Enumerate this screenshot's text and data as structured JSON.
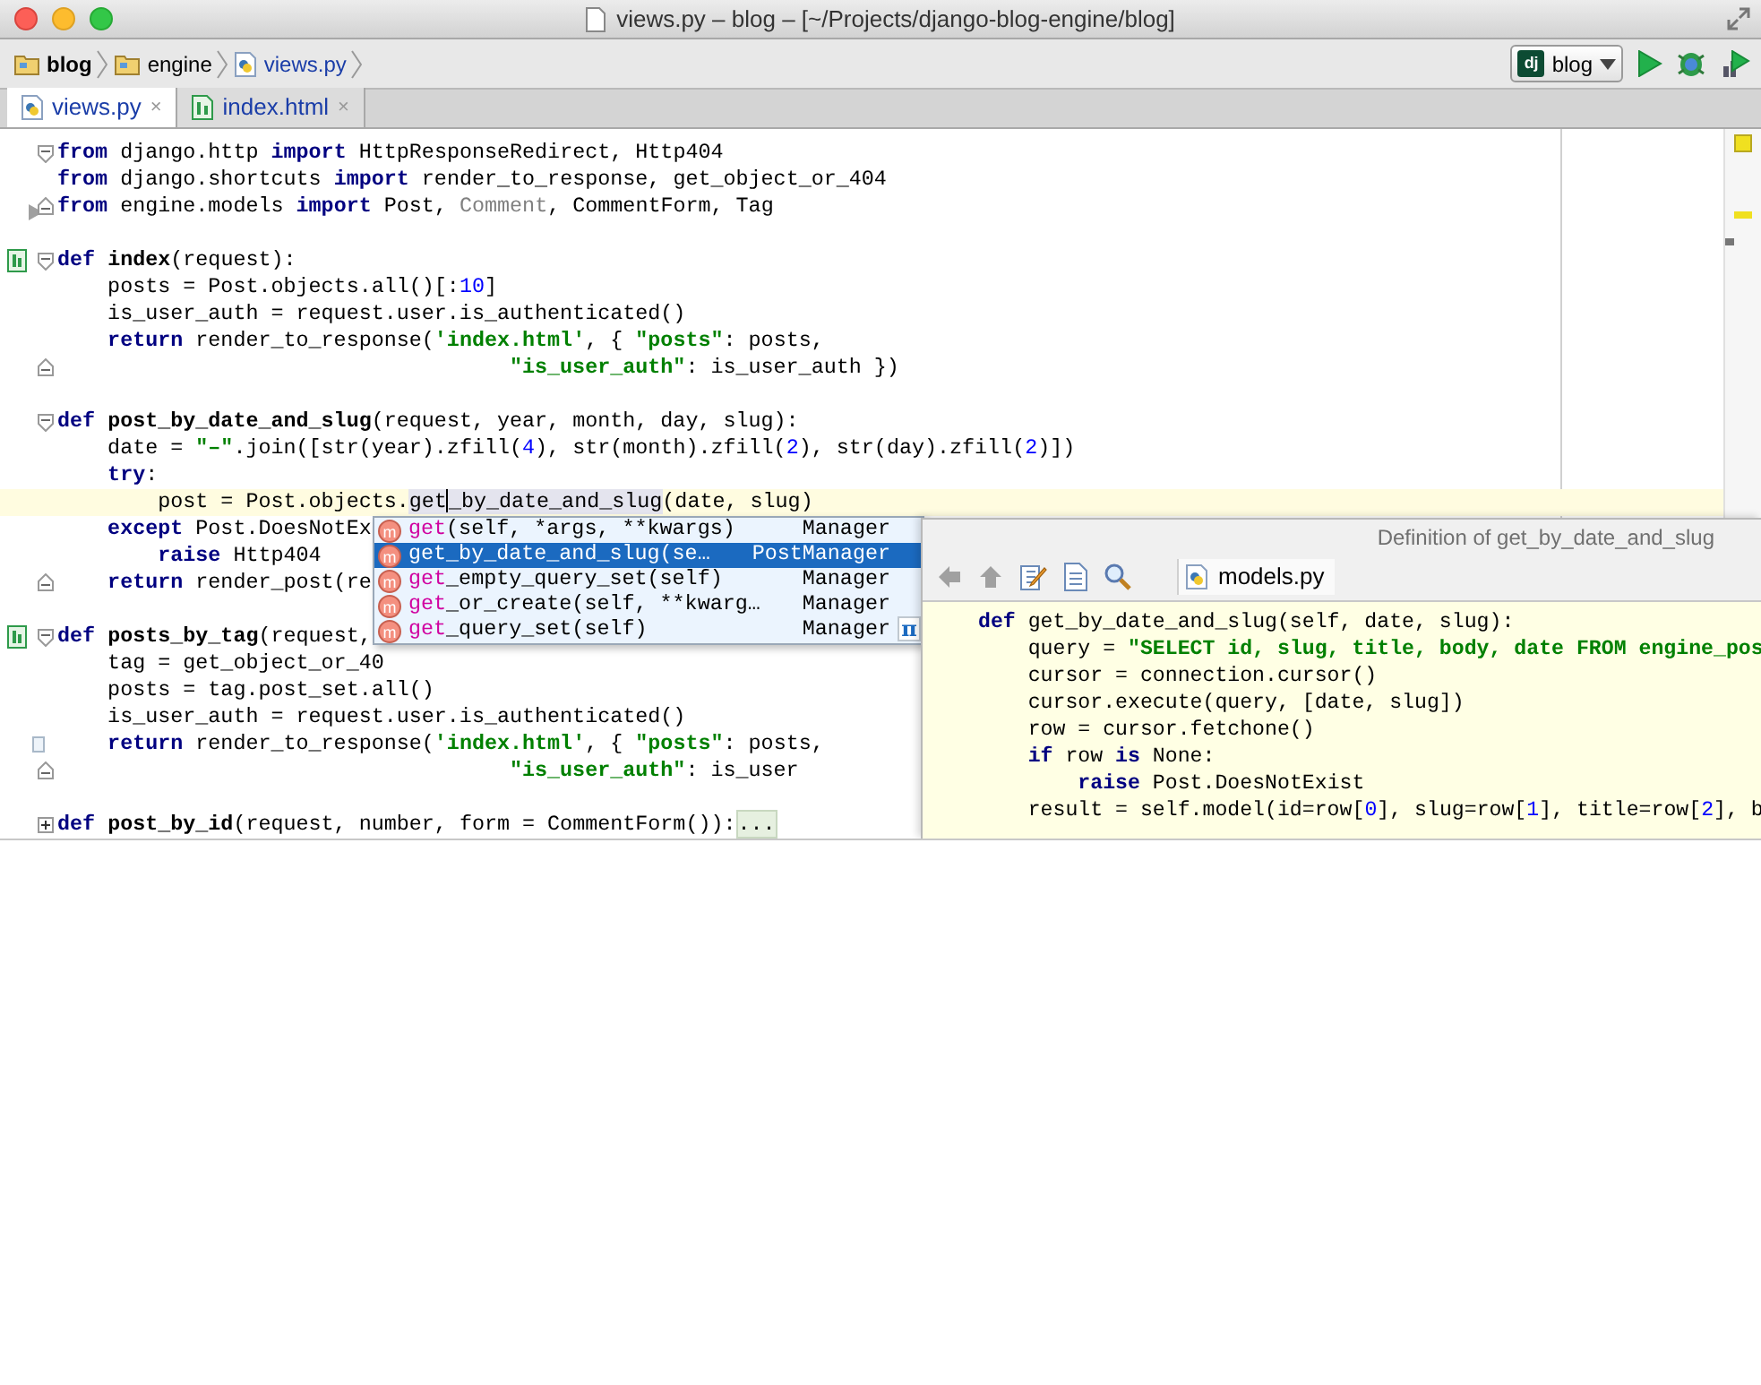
{
  "window": {
    "title": "views.py – blog – [~/Projects/django-blog-engine/blog]"
  },
  "breadcrumbs": [
    {
      "label": "blog",
      "kind": "folder",
      "bold": true
    },
    {
      "label": "engine",
      "kind": "folder",
      "bold": false
    },
    {
      "label": "views.py",
      "kind": "python",
      "bold": false
    }
  ],
  "run_config": {
    "badge": "dj",
    "label": "blog"
  },
  "tabs": [
    {
      "label": "views.py",
      "kind": "python",
      "selected": true,
      "close": "×"
    },
    {
      "label": "index.html",
      "kind": "html",
      "selected": false,
      "close": "×"
    }
  ],
  "editor": {
    "lines": [
      {
        "kind": "open",
        "current": false,
        "tokens": [
          {
            "kind": "kw",
            "text": "from"
          },
          {
            "kind": "plain",
            "text": " django.http "
          },
          {
            "kind": "kw",
            "text": "import"
          },
          {
            "kind": "plain",
            "text": " HttpResponseRedirect, Http404"
          }
        ]
      },
      {
        "kind": "plain",
        "current": false,
        "tokens": [
          {
            "kind": "kw",
            "text": "from"
          },
          {
            "kind": "plain",
            "text": " django.shortcuts "
          },
          {
            "kind": "kw",
            "text": "import"
          },
          {
            "kind": "plain",
            "text": " render_to_response, get_object_or_404"
          }
        ]
      },
      {
        "kind": "arrowclose",
        "current": false,
        "tokens": [
          {
            "kind": "kw",
            "text": "from"
          },
          {
            "kind": "plain",
            "text": " engine.models "
          },
          {
            "kind": "kw",
            "text": "import"
          },
          {
            "kind": "plain",
            "text": " Post, "
          },
          {
            "kind": "dim",
            "text": "Comment"
          },
          {
            "kind": "plain",
            "text": ", CommentForm, Tag"
          }
        ]
      },
      {
        "kind": "plain",
        "current": false
      },
      {
        "kind": "method",
        "current": false,
        "tokens": [
          {
            "kind": "kw",
            "text": "def "
          },
          {
            "kind": "fn",
            "text": "index"
          },
          {
            "kind": "plain",
            "text": "(request):"
          }
        ]
      },
      {
        "kind": "plain",
        "current": false,
        "tokens": [
          {
            "kind": "plain",
            "text": "    posts = Post.objects.all()[:"
          },
          {
            "kind": "num",
            "text": "10"
          },
          {
            "kind": "plain",
            "text": "]"
          }
        ]
      },
      {
        "kind": "plain",
        "current": false,
        "tokens": [
          {
            "kind": "plain",
            "text": "    is_user_auth = request.user.is_authenticated()"
          }
        ]
      },
      {
        "kind": "plain",
        "current": false,
        "tokens": [
          {
            "kind": "kw",
            "text": "    return"
          },
          {
            "kind": "plain",
            "text": " render_to_response("
          },
          {
            "kind": "str",
            "text": "'index.html'"
          },
          {
            "kind": "plain",
            "text": ", { "
          },
          {
            "kind": "str",
            "text": "\"posts\""
          },
          {
            "kind": "plain",
            "text": ": posts,"
          }
        ]
      },
      {
        "kind": "close",
        "current": false,
        "tokens": [
          {
            "kind": "str",
            "text": "                                    \"is_user_auth\""
          },
          {
            "kind": "plain",
            "text": ": is_user_auth })"
          }
        ]
      },
      {
        "kind": "plain",
        "current": false
      },
      {
        "kind": "open",
        "current": false,
        "tokens": [
          {
            "kind": "kw",
            "text": "def "
          },
          {
            "kind": "fn",
            "text": "post_by_date_and_slug"
          },
          {
            "kind": "plain",
            "text": "(request, year, month, day, slug):"
          }
        ]
      },
      {
        "kind": "plain",
        "current": false,
        "tokens": [
          {
            "kind": "plain",
            "text": "    date = "
          },
          {
            "kind": "str",
            "text": "\"–\""
          },
          {
            "kind": "plain",
            "text": ".join([str(year).zfill("
          },
          {
            "kind": "num",
            "text": "4"
          },
          {
            "kind": "plain",
            "text": "), str(month).zfill("
          },
          {
            "kind": "num",
            "text": "2"
          },
          {
            "kind": "plain",
            "text": "), str(day).zfill("
          },
          {
            "kind": "num",
            "text": "2"
          },
          {
            "kind": "plain",
            "text": ")])"
          }
        ]
      },
      {
        "kind": "plain",
        "current": false,
        "tokens": [
          {
            "kind": "kw",
            "text": "    try"
          },
          {
            "kind": "plain",
            "text": ":"
          }
        ]
      },
      {
        "kind": "plain",
        "current": true,
        "tokens": [
          {
            "kind": "plain",
            "text": "        post = Post.objects."
          },
          {
            "kind": "ref",
            "text": "get",
            "caret": true
          },
          {
            "kind": "ref",
            "text": "_by_date_and_slug"
          },
          {
            "kind": "plain",
            "text": "(date, slug)"
          }
        ]
      },
      {
        "kind": "plain",
        "current": false,
        "tokens": [
          {
            "kind": "kw",
            "text": "    except"
          },
          {
            "kind": "plain",
            "text": " Post.DoesNotEx"
          }
        ]
      },
      {
        "kind": "plain",
        "current": false,
        "tokens": [
          {
            "kind": "kw",
            "text": "        raise"
          },
          {
            "kind": "plain",
            "text": " Http404"
          }
        ]
      },
      {
        "kind": "close",
        "current": false,
        "tokens": [
          {
            "kind": "kw",
            "text": "    return"
          },
          {
            "kind": "plain",
            "text": " render_post(re"
          }
        ]
      },
      {
        "kind": "plain",
        "current": false
      },
      {
        "kind": "method",
        "current": false,
        "tokens": [
          {
            "kind": "kw",
            "text": "def "
          },
          {
            "kind": "fn",
            "text": "posts_by_tag"
          },
          {
            "kind": "plain",
            "text": "(request,"
          }
        ]
      },
      {
        "kind": "plain",
        "current": false,
        "tokens": [
          {
            "kind": "plain",
            "text": "    tag = get_object_or_40"
          }
        ]
      },
      {
        "kind": "plain",
        "current": false,
        "tokens": [
          {
            "kind": "plain",
            "text": "    posts = tag.post_set.all()"
          }
        ]
      },
      {
        "kind": "plain",
        "current": false,
        "tokens": [
          {
            "kind": "plain",
            "text": "    is_user_auth = request.user.is_authenticated()"
          }
        ]
      },
      {
        "kind": "bookmark",
        "current": false,
        "tokens": [
          {
            "kind": "kw",
            "text": "    return"
          },
          {
            "kind": "plain",
            "text": " render_to_response("
          },
          {
            "kind": "str",
            "text": "'index.html'"
          },
          {
            "kind": "plain",
            "text": ", { "
          },
          {
            "kind": "str",
            "text": "\"posts\""
          },
          {
            "kind": "plain",
            "text": ": posts,"
          }
        ]
      },
      {
        "kind": "close",
        "current": false,
        "tokens": [
          {
            "kind": "str",
            "text": "                                    \"is_user_auth\""
          },
          {
            "kind": "plain",
            "text": ": is_user"
          }
        ]
      },
      {
        "kind": "plain",
        "current": false
      },
      {
        "kind": "collapsed",
        "current": false,
        "tokens": [
          {
            "kind": "kw",
            "text": "def "
          },
          {
            "kind": "fn",
            "text": "post_by_id"
          },
          {
            "kind": "plain",
            "text": "(request, number, form = CommentForm()):"
          },
          {
            "kind": "folded",
            "text": "..."
          }
        ]
      }
    ]
  },
  "completion": {
    "items": [
      {
        "icon_letter": "m",
        "match": "get",
        "rest": "(self, *args, **kwargs)",
        "type": "Manager",
        "selected": false
      },
      {
        "icon_letter": "m",
        "match": "get",
        "rest": "_by_date_and_slug(se…",
        "type": "PostManager",
        "selected": true
      },
      {
        "icon_letter": "m",
        "match": "get",
        "rest": "_empty_query_set(self)",
        "type": "Manager",
        "selected": false
      },
      {
        "icon_letter": "m",
        "match": "get",
        "rest": "_or_create(self, **kwarg…",
        "type": "Manager",
        "selected": false
      },
      {
        "icon_letter": "m",
        "match": "get",
        "rest": "_query_set(self)",
        "type": "Manager",
        "selected": false
      }
    ],
    "footer": "π"
  },
  "definition": {
    "title": "Definition of get_by_date_and_slug",
    "file": "models.py",
    "lines": [
      {
        "tokens": [
          {
            "kind": "kw",
            "text": "def"
          },
          {
            "kind": "plain",
            "text": " get_by_date_and_slug(self, date, slug):"
          }
        ]
      },
      {
        "tokens": [
          {
            "kind": "plain",
            "text": "    query = "
          },
          {
            "kind": "str",
            "text": "\"SELECT id, slug, title, body, date FROM engine_pos"
          }
        ]
      },
      {
        "tokens": [
          {
            "kind": "plain",
            "text": "    cursor = connection.cursor()"
          }
        ]
      },
      {
        "tokens": [
          {
            "kind": "plain",
            "text": "    cursor.execute(query, [date, slug])"
          }
        ]
      },
      {
        "tokens": [
          {
            "kind": "plain",
            "text": "    row = cursor.fetchone()"
          }
        ]
      },
      {
        "tokens": [
          {
            "kind": "kw",
            "text": "    if"
          },
          {
            "kind": "plain",
            "text": " row "
          },
          {
            "kind": "kw",
            "text": "is"
          },
          {
            "kind": "plain",
            "text": " None:"
          }
        ]
      },
      {
        "tokens": [
          {
            "kind": "kw",
            "text": "        raise"
          },
          {
            "kind": "plain",
            "text": " Post.DoesNotExist"
          }
        ]
      },
      {
        "tokens": [
          {
            "kind": "plain",
            "text": "    result = self.model(id=row["
          },
          {
            "kind": "num",
            "text": "0"
          },
          {
            "kind": "plain",
            "text": "], slug=row["
          },
          {
            "kind": "num",
            "text": "1"
          },
          {
            "kind": "plain",
            "text": "], title=row["
          },
          {
            "kind": "num",
            "text": "2"
          },
          {
            "kind": "plain",
            "text": "], b"
          }
        ]
      }
    ]
  }
}
